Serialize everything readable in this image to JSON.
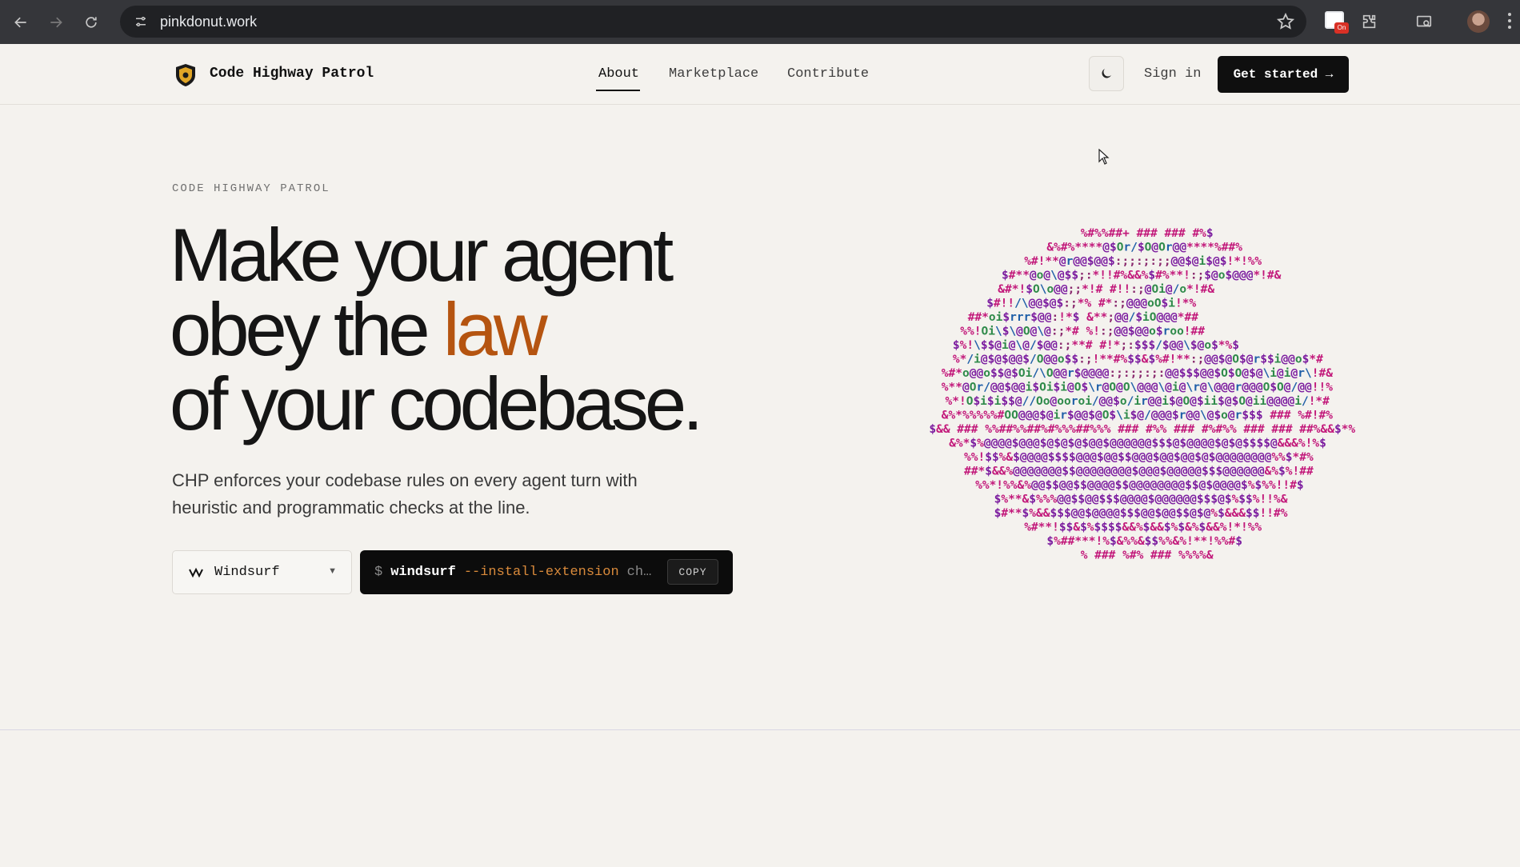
{
  "browser": {
    "url": "pinkdonut.work",
    "icons": [
      "back-icon",
      "forward-icon",
      "reload-icon",
      "site-info-icon",
      "star-icon",
      "extension-icon",
      "puzzle-icon",
      "cast-icon",
      "profile-avatar",
      "menu-icon"
    ],
    "recording_badge": "On"
  },
  "header": {
    "brand": "Code Highway Patrol",
    "nav": [
      "About",
      "Marketplace",
      "Contribute"
    ],
    "active_nav": "About",
    "sign_in": "Sign in",
    "cta": "Get started →"
  },
  "hero": {
    "eyebrow": "CODE HIGHWAY PATROL",
    "headline_line1": "Make your agent",
    "headline_line2_pre": "obey the ",
    "headline_line2_accent": "law",
    "headline_line3": "of your codebase.",
    "subtitle": "CHP enforces your codebase rules on every agent turn with heuristic and programmatic checks at the line.",
    "editor_select": "Windsurf",
    "command": {
      "prompt": "$",
      "bin": "windsurf",
      "flag": "--install-extension",
      "arg": "ch…"
    },
    "copy_label": "COPY"
  },
  "ascii_art": [
    "%#%%##+ ### ### #%$",
    "&%#%****@$Or/$O@Or@@****%##%",
    "%#!**@r@@$@@$:;;:;:;;@@$@i$@$!*!%%",
    "$#**@o@\\@$$;:*!!#%&&%$#%**!:;$@o$@@@*!#&",
    "&#*!$O\\o@@;;*!#           #!!:;@Oi@/o*!#&",
    "$#!!/\\@@$@$:;*%               #*:;@@@oO$i!*%",
    "##*oi$rrr$@@:!*$                 &**;@@/$iO@@@*##",
    "%%!Oi\\$\\@O@\\@:;*#                 %!:;@@$@@o$roo!##",
    "$%!\\$$@i@\\@/$@@:;**#             #!*;:$$$/$@@\\$@o$*%$",
    "%*/i@$@$@@$/O@@o$$:;!**#%$$&$%#!**:;@@$@O$@r$$i@@o$*#",
    "%#*o@@o$$@$Oi/\\O@@r$@@@@:;:;;:;:@@$$$@@$O$O@$@\\i@i@r\\!#&",
    "%**@Or/@@$@@i$Oi$i@O$\\r@O@O\\@@@\\@i@\\r@\\@@@r@@@O$O@/@@!!%",
    "%*!O$i$i$$@//Oo@ooroi/@@$o/ir@@i$@O@$ii$@$O@ii@@@@i/!*#",
    "&%*%%%%%#OO@@@$@ir$@@$@O$\\i$@/@@@$r@@\\@$o@r$$$ ### %#!#%",
    "#!$&& ### %%##%%##%#%%%##%%% ### #%% ### #%#%% ### ### ##%&&$*%",
    "&%*$%@@@@$@@@$@$@$@$@@$@@@@@@$$$@$@@@@$@$@$$$$@&&&%!%$",
    "%%!$$%&$@@@@$$$$@@@$@@$$@@@$@@$@@$@$@@@@@@@@%%$*#%",
    "##*$&&%@@@@@@@$$@@@@@@@@$@@@$@@@@@$$$@@@@@@&%$%!##",
    "%%*!%%&%@@$$@@$$@@@@$$@@@@@@@@$$@$@@@@$%$%%!!#$",
    "$%**&$%%%@@$$@@$$$@@@@$@@@@@@$$$@$%$$%!!%&",
    "$#**$%&&$$$@@$@@@@$$$@@$@@$$@$@%$&&&$$!!#%",
    "%#**!$$&$%$$$$&&%$&&$%$&%$&&%!*!%%",
    "$%##***!%$&%%&$$%%&%!**!%%#$",
    "% ### %#% ### %%%%&"
  ]
}
